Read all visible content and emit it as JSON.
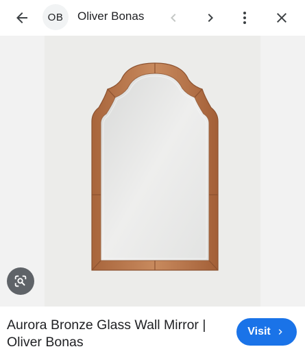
{
  "header": {
    "avatar_text": "OB",
    "site_name": "Oliver Bonas",
    "icons": {
      "back": "arrow-left-icon",
      "prev": "chevron-left-icon",
      "next": "chevron-right-icon",
      "more": "more-vert-icon",
      "close": "close-icon"
    }
  },
  "image": {
    "subject": "mirror",
    "frame_color": "#b6744a",
    "glass_color": "#e6e7e6",
    "background_color": "#ececea"
  },
  "lens": {
    "icon": "lens-search-icon"
  },
  "result": {
    "title": "Aurora Bronze Glass Wall Mirror | Oliver Bonas",
    "visit_label": "Visit",
    "visit_icon": "chevron-right-icon",
    "accent": "#1a73e8"
  }
}
